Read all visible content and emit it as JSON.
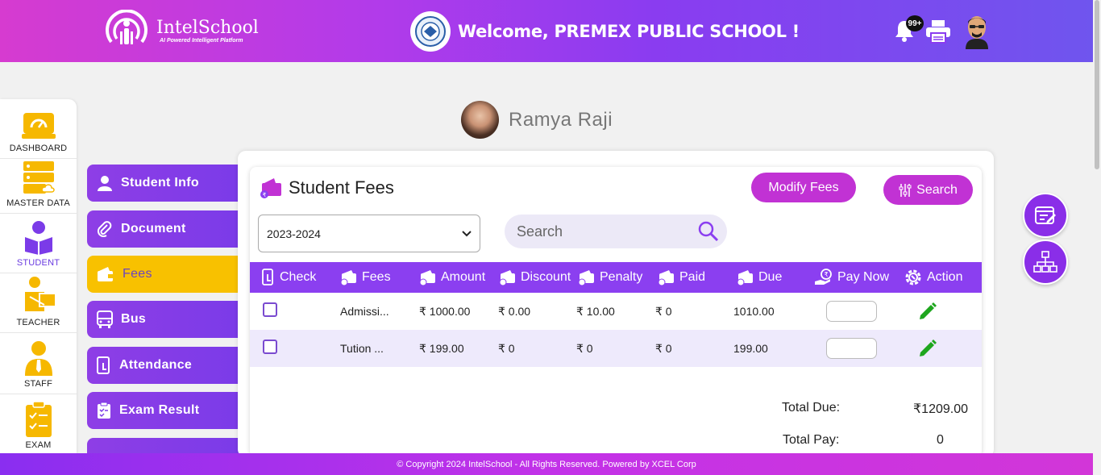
{
  "header": {
    "brand_name": "IntelSchool",
    "brand_tagline": "AI Powered Intelligent Platform",
    "welcome": "Welcome, PREMEX PUBLIC SCHOOL !",
    "notification_count": "99+"
  },
  "left_nav": [
    {
      "label": "DASHBOARD",
      "icon": "dashboard-icon"
    },
    {
      "label": "MASTER DATA",
      "icon": "master-data-icon"
    },
    {
      "label": "STUDENT",
      "icon": "student-icon",
      "active": true
    },
    {
      "label": "TEACHER",
      "icon": "teacher-icon"
    },
    {
      "label": "STAFF",
      "icon": "staff-icon"
    },
    {
      "label": "EXAM",
      "icon": "exam-icon"
    }
  ],
  "profile": {
    "name": "Ramya Raji"
  },
  "side_tabs": [
    {
      "label": "Student Info",
      "icon": "user-icon"
    },
    {
      "label": "Document",
      "icon": "paperclip-icon"
    },
    {
      "label": "Fees",
      "icon": "wallet-icon",
      "active": true
    },
    {
      "label": "Bus",
      "icon": "bus-icon"
    },
    {
      "label": "Attendance",
      "icon": "touch-icon"
    },
    {
      "label": "Exam Result",
      "icon": "clipboard-icon"
    }
  ],
  "fees": {
    "title": "Student Fees",
    "modify_button": "Modify Fees",
    "search_button": "Search",
    "year_selected": "2023-2024",
    "search_placeholder": "Search",
    "columns": [
      "Check",
      "Fees",
      "Amount",
      "Discount",
      "Penalty",
      "Paid",
      "Due",
      "Pay Now",
      "Action"
    ],
    "rows": [
      {
        "fees": "Admissi...",
        "amount": "₹ 1000.00",
        "discount": "₹ 0.00",
        "penalty": "₹ 10.00",
        "paid": "₹ 0",
        "due": "1010.00"
      },
      {
        "fees": "Tution ...",
        "amount": "₹ 199.00",
        "discount": "₹ 0",
        "penalty": "₹ 0",
        "paid": "₹ 0",
        "due": "199.00"
      }
    ],
    "total_due_label": "Total Due:",
    "total_due_value": "₹1209.00",
    "total_pay_label": "Total Pay:",
    "total_pay_value": "0"
  },
  "footer": {
    "text": "© Copyright 2024 IntelSchool - All Rights Reserved. Powered by XCEL Corp"
  },
  "colors": {
    "primary": "#8b3ff0",
    "accent": "#c132d4",
    "active_tab": "#f8c100",
    "nav_icon": "#f6b800"
  }
}
